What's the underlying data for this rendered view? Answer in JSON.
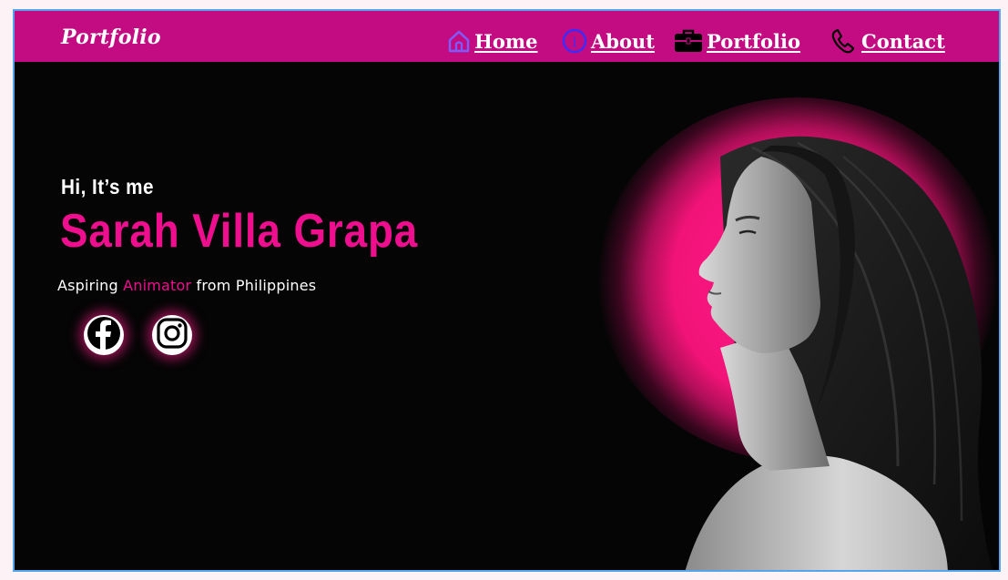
{
  "nav": {
    "brand": "Portfolio",
    "items": [
      {
        "label": "Home",
        "icon": "home-icon"
      },
      {
        "label": "About",
        "icon": "info-icon"
      },
      {
        "label": "Portfolio",
        "icon": "briefcase-icon"
      },
      {
        "label": "Contact",
        "icon": "phone-icon"
      }
    ]
  },
  "hero": {
    "greeting": "Hi, It’s me",
    "name": "Sarah Villa Grapa",
    "tagline": {
      "prefix": "Aspiring ",
      "highlight": "Animator",
      "suffix": " from Philippines"
    },
    "social": [
      {
        "icon": "facebook-icon"
      },
      {
        "icon": "instagram-icon"
      }
    ]
  },
  "colors": {
    "navbar": "#c40c82",
    "accent": "#ee0e8e",
    "background": "#050505",
    "frame_border": "#55a4ee",
    "nav_icon_home": "#7b5cff",
    "nav_icon_about": "#3a2cff"
  }
}
